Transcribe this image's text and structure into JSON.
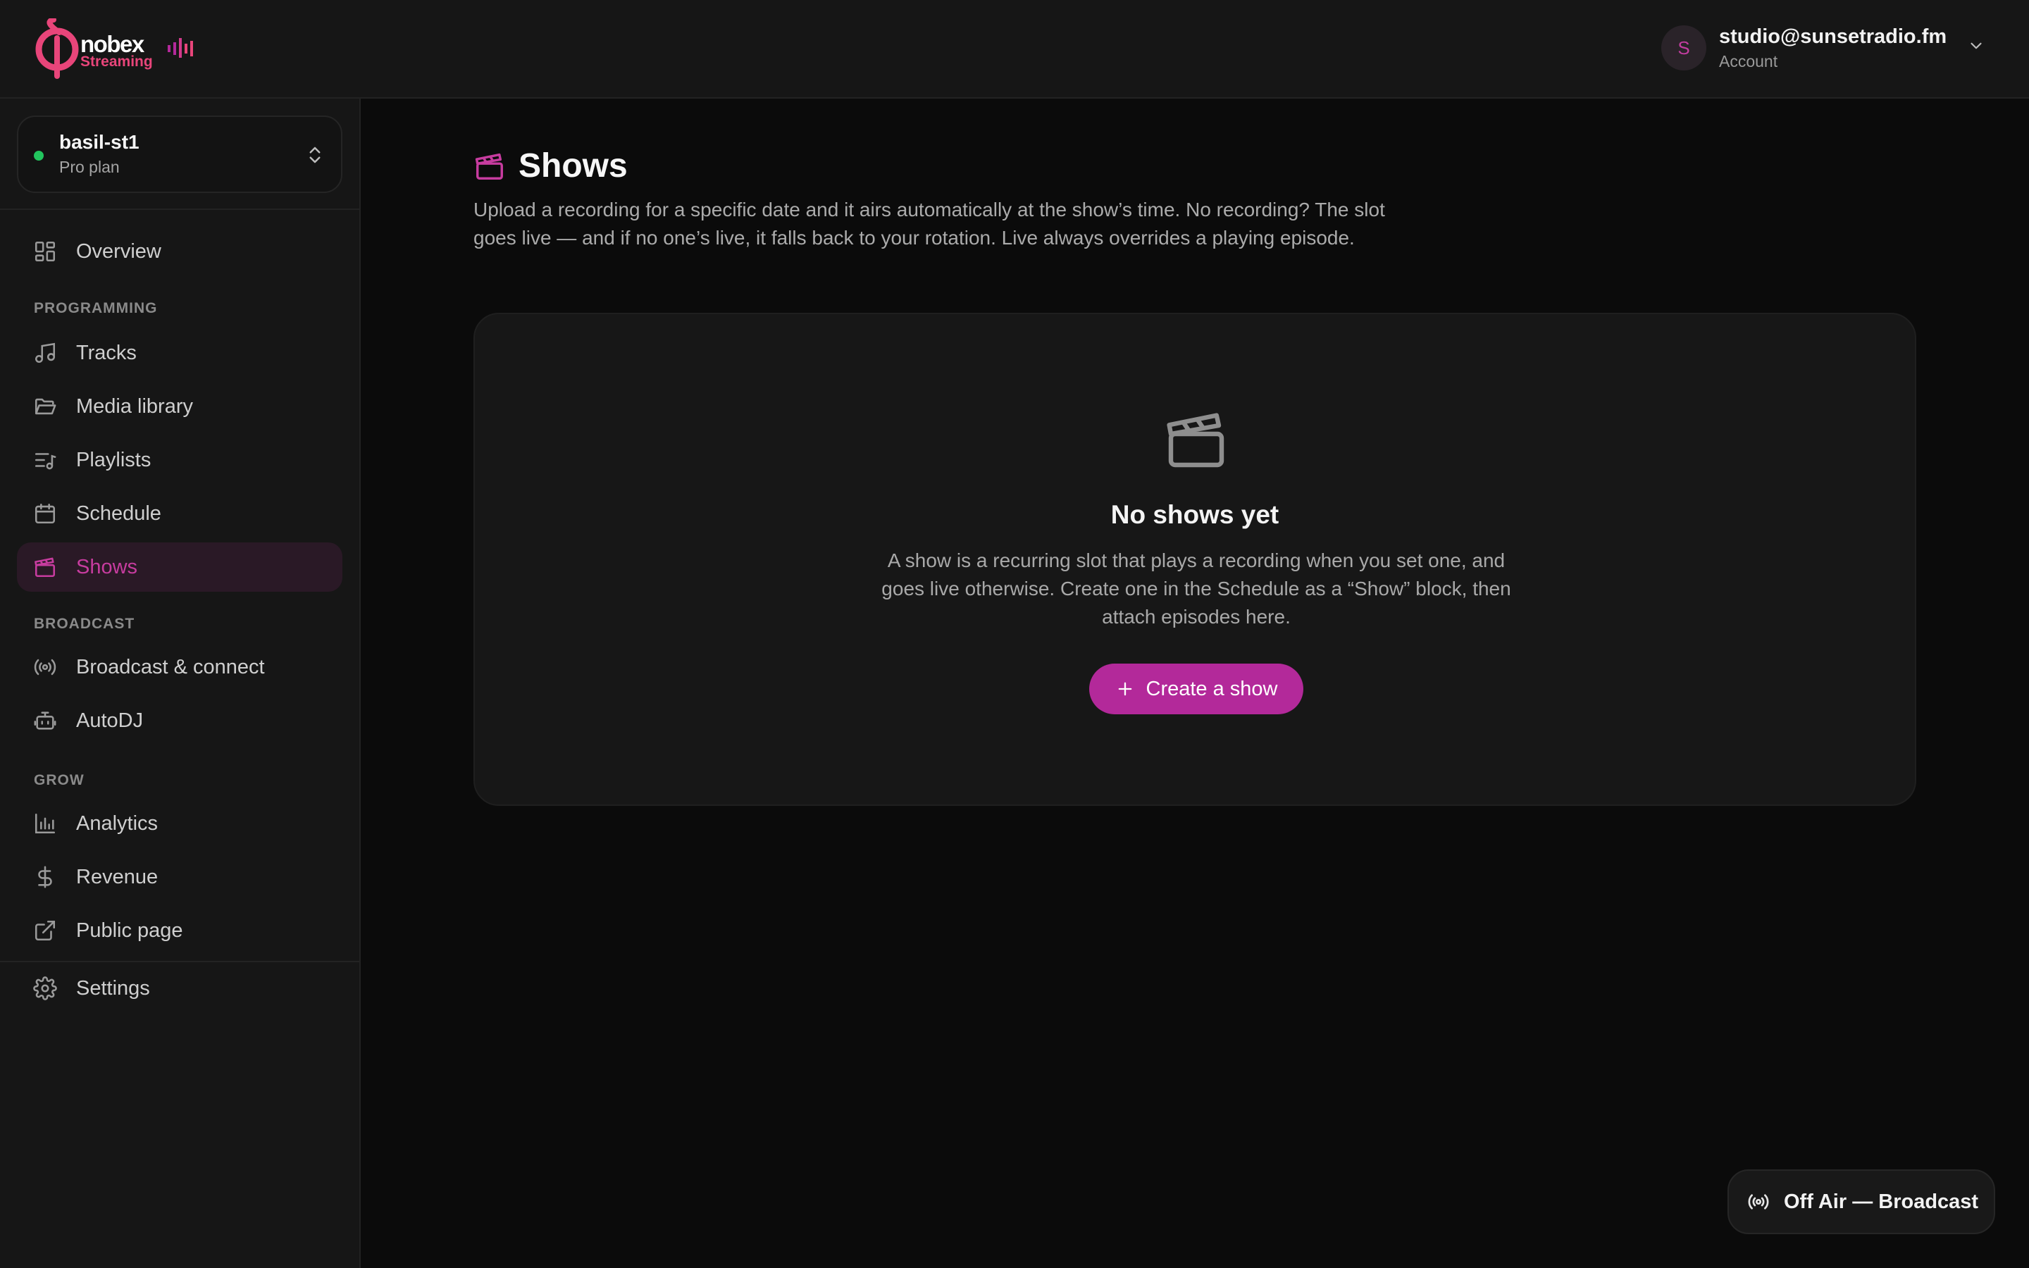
{
  "brand": {
    "name": "nobex",
    "subtitle": "Streaming",
    "accent": "#e8457a"
  },
  "account": {
    "avatar_initial": "S",
    "email": "studio@sunsetradio.fm",
    "label": "Account"
  },
  "station": {
    "name": "basil-st1",
    "plan": "Pro plan",
    "status_color": "#22c55e"
  },
  "sidebar": {
    "overview": "Overview",
    "sections": {
      "programming": "PROGRAMMING",
      "broadcast": "BROADCAST",
      "grow": "GROW"
    },
    "items": {
      "tracks": "Tracks",
      "media_library": "Media library",
      "playlists": "Playlists",
      "schedule": "Schedule",
      "shows": "Shows",
      "broadcast_connect": "Broadcast & connect",
      "autodj": "AutoDJ",
      "analytics": "Analytics",
      "revenue": "Revenue",
      "public_page": "Public page",
      "settings": "Settings"
    },
    "active": "shows"
  },
  "page": {
    "title": "Shows",
    "description": "Upload a recording for a specific date and it airs automatically at the show’s time. No recording? The slot goes live — and if no one’s live, it falls back to your rotation. Live always overrides a playing episode."
  },
  "empty_state": {
    "icon": "clapperboard-icon",
    "title": "No shows yet",
    "description": "A show is a recurring slot that plays a recording when you set one, and goes live otherwise. Create one in the Schedule as a “Show” block, then attach episodes here.",
    "button_label": "Create a show",
    "button_color": "#b3299a"
  },
  "broadcast_pill": {
    "label": "Off Air — Broadcast"
  }
}
